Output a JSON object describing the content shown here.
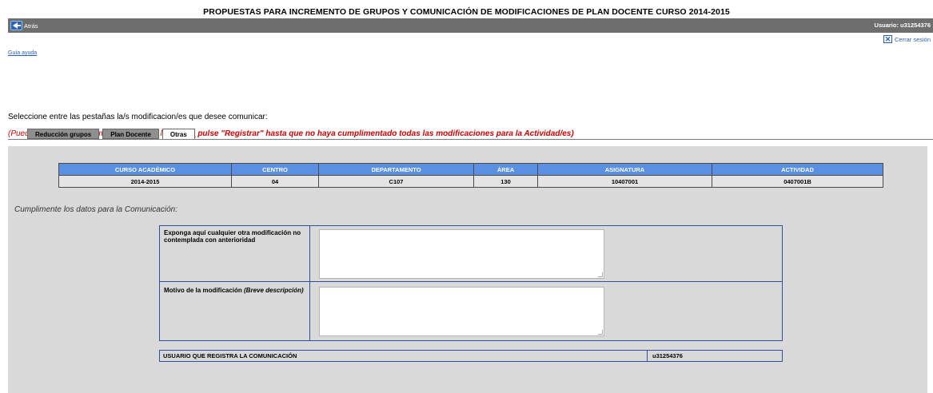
{
  "page_title": "PROPUESTAS PARA INCREMENTO DE GRUPOS Y COMUNICACIÓN DE MODIFICACIONES DE PLAN DOCENTE CURSO 2014-2015",
  "topbar": {
    "back_label": "Atrás",
    "user_label": "Usuario: u31254376"
  },
  "logout_label": "Cerrar sesión",
  "help_link": "Guía ayuda",
  "instruction": "Seleccione entre las pestañas la/s modificacion/es que desee comunicar:",
  "warning": {
    "part1": "(Puede comunicar varias modificaciones a la vez, ",
    "no": "no",
    "part2": " pulse \"Registrar\" hasta que no haya cumplimentado todas las modificaciones para la Actividad/es)"
  },
  "tabs": [
    {
      "label": "Reducción grupos",
      "active": false
    },
    {
      "label": "Plan Docente",
      "active": false
    },
    {
      "label": "Otras",
      "active": true
    }
  ],
  "info_table": {
    "headers": [
      "CURSO ACADÉMICO",
      "CENTRO",
      "DEPARTAMENTO",
      "ÁREA",
      "ASIGNATURA",
      "ACTIVIDAD"
    ],
    "row": [
      "2014-2015",
      "04",
      "C107",
      "130",
      "10407001",
      "0407001B"
    ]
  },
  "form_intro": "Cumplimente los datos para la Comunicación:",
  "form": {
    "field1_label": "Exponga aquí cualquier otra modificación no contemplada con anterioridad",
    "field1_value": "",
    "field2_label": "Motivo de la modificación ",
    "field2_label_italic": "(Breve descripción)",
    "field2_value": ""
  },
  "registrant": {
    "label": "USUARIO QUE REGISTRA LA COMUNICACIÓN",
    "value": "u31254376"
  },
  "colors": {
    "topbar": "#6e6e6e",
    "table_header": "#5b8fe0",
    "warning": "#cc0000",
    "panel": "#d9d9d9",
    "link": "#2d5fb0"
  }
}
